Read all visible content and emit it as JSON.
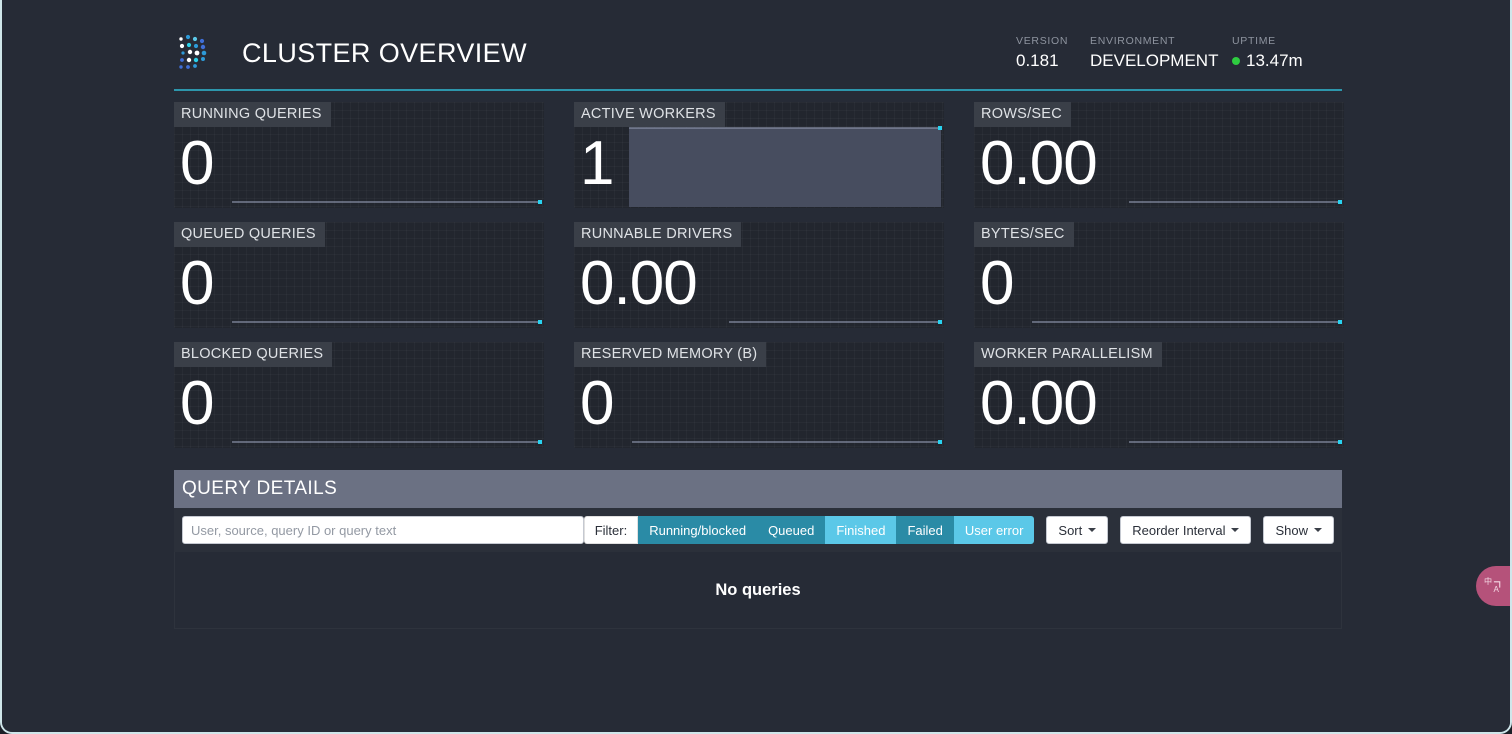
{
  "header": {
    "logo_icon": "trino-dots-logo-icon",
    "title": "CLUSTER OVERVIEW",
    "stats": [
      {
        "label": "VERSION",
        "value": "0.181",
        "key": "version"
      },
      {
        "label": "ENVIRONMENT",
        "value": "DEVELOPMENT",
        "key": "environment"
      },
      {
        "label": "UPTIME",
        "value": "13.47m",
        "key": "uptime",
        "status_dot_color": "#2ecc40"
      }
    ]
  },
  "theme": {
    "page_bg": "#262b36",
    "card_bg": "#22262e",
    "label_bg": "#3a3f48",
    "accent_rule": "#2d96ac",
    "spark_line": "#8891a6",
    "spark_fill": "#474d5f",
    "spark_dot": "#29d2f0",
    "panel_header_bg": "#6b7183",
    "filter_dark": "#2a8ba6",
    "filter_light": "#5bc8e8"
  },
  "metrics": [
    {
      "label": "RUNNING QUERIES",
      "value": "0",
      "spark_type": "flat"
    },
    {
      "label": "ACTIVE WORKERS",
      "value": "1",
      "spark_type": "filled"
    },
    {
      "label": "ROWS/SEC",
      "value": "0.00",
      "spark_type": "flat-short"
    },
    {
      "label": "QUEUED QUERIES",
      "value": "0",
      "spark_type": "flat"
    },
    {
      "label": "RUNNABLE DRIVERS",
      "value": "0.00",
      "spark_type": "flat-short"
    },
    {
      "label": "BYTES/SEC",
      "value": "0",
      "spark_type": "flat"
    },
    {
      "label": "BLOCKED QUERIES",
      "value": "0",
      "spark_type": "flat"
    },
    {
      "label": "RESERVED MEMORY (B)",
      "value": "0",
      "spark_type": "flat"
    },
    {
      "label": "WORKER PARALLELISM",
      "value": "0.00",
      "spark_type": "flat-short"
    }
  ],
  "query_details": {
    "title": "QUERY DETAILS",
    "search_placeholder": "User, source, query ID or query text",
    "search_value": "",
    "filter_label": "Filter:",
    "filters": [
      {
        "label": "Running/blocked",
        "style": "dark"
      },
      {
        "label": "Queued",
        "style": "dark"
      },
      {
        "label": "Finished",
        "style": "light"
      },
      {
        "label": "Failed",
        "style": "dark"
      },
      {
        "label": "User error",
        "style": "light"
      }
    ],
    "dropdowns": [
      {
        "label": "Sort",
        "name": "sort"
      },
      {
        "label": "Reorder Interval",
        "name": "reorder-interval"
      },
      {
        "label": "Show",
        "name": "show"
      }
    ],
    "empty_message": "No queries"
  },
  "translate_widget": {
    "glyph": "中ﾌ",
    "icon": "translate-icon",
    "color": "#b5527a"
  }
}
